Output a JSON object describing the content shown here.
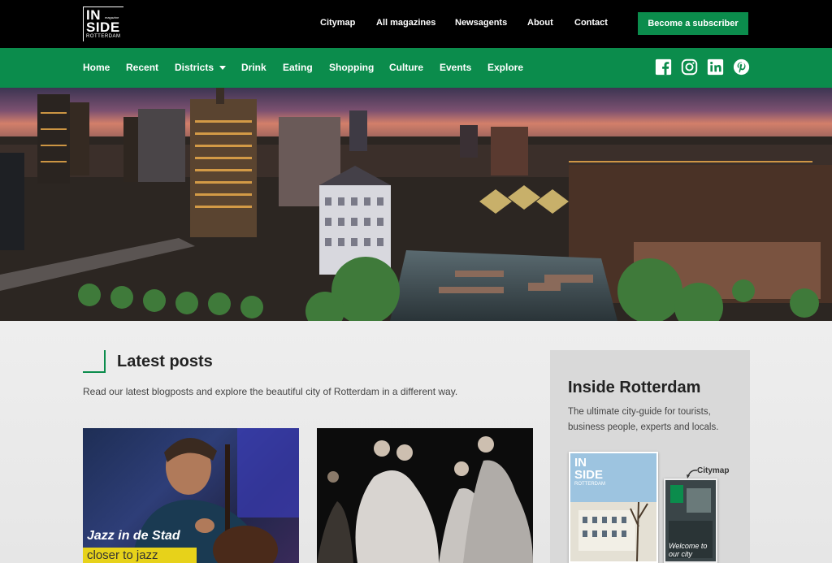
{
  "brand": {
    "line1": "IN",
    "line2": "SIDE",
    "line3": "ROTTERDAM",
    "magazine_tag": "magazine",
    "green": "#0b8c4c"
  },
  "topnav": {
    "items": [
      "Citymap",
      "All magazines",
      "Newsagents",
      "About",
      "Contact"
    ],
    "subscribe_label": "Become a subscriber"
  },
  "mainnav": {
    "items": [
      "Home",
      "Recent",
      "Districts",
      "Drink",
      "Eating",
      "Shopping",
      "Culture",
      "Events",
      "Explore"
    ],
    "dropdown_item": "Districts",
    "social_icons": [
      "facebook-icon",
      "instagram-icon",
      "linkedin-icon",
      "pinterest-icon"
    ]
  },
  "hero": {
    "image": "rotterdam-skyline-night-aerial"
  },
  "latest_posts": {
    "title": "Latest posts",
    "description": "Read our latest blogposts and explore the beautiful city of Rotterdam in a different way.",
    "cards": [
      {
        "caption": "Jazz in de Stad",
        "tag": "closer to jazz",
        "image": "double-bass-player"
      },
      {
        "caption": "",
        "tag": "",
        "image": "dancers-on-stage"
      }
    ]
  },
  "sidebar": {
    "title": "Inside Rotterdam",
    "description": "The ultimate city-guide for tourists, business people, experts and locals.",
    "magazine_cover_title_1": "IN",
    "magazine_cover_title_2": "SIDE",
    "magazine_cover_sub": "ROTTERDAM",
    "citymap_label": "Citymap",
    "citymap_cover_text": "Welcome to our city"
  }
}
